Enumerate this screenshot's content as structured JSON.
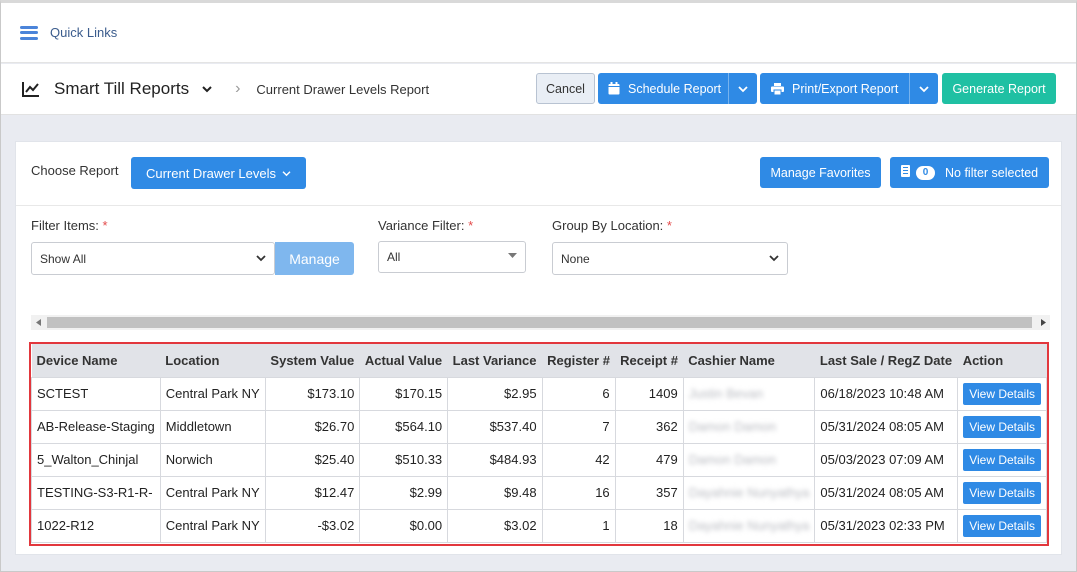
{
  "quick_links": {
    "label": "Quick Links"
  },
  "header": {
    "title": "Smart Till Reports",
    "breadcrumb": "Current Drawer Levels Report",
    "cancel_label": "Cancel",
    "schedule_label": "Schedule Report",
    "print_label": "Print/Export Report",
    "generate_label": "Generate Report"
  },
  "report": {
    "choose_label": "Choose Report",
    "selected_report": "Current Drawer Levels",
    "favorites_label": "Manage Favorites",
    "filter_count": "0",
    "filter_label": "No filter selected"
  },
  "filters": {
    "filter_items_label": "Filter Items:",
    "filter_items_value": "Show All",
    "manage_label": "Manage",
    "variance_label": "Variance Filter:",
    "variance_value": "All",
    "group_label": "Group By Location:",
    "group_value": "None",
    "required_mark": "*"
  },
  "table": {
    "columns": [
      "Device Name",
      "Location",
      "System Value",
      "Actual Value",
      "Last Variance",
      "Register #",
      "Receipt #",
      "Cashier Name",
      "Last Sale / RegZ Date",
      "Action"
    ],
    "rows": [
      {
        "device": "SCTEST",
        "location": "Central Park NY",
        "system": "$173.10",
        "actual": "$170.15",
        "variance": "$2.95",
        "register": "6",
        "receipt": "1409",
        "cashier": "Justin Bevan",
        "date": "06/18/2023 10:48 AM",
        "action": "View Details"
      },
      {
        "device": "AB-Release-Staging",
        "location": "Middletown",
        "system": "$26.70",
        "actual": "$564.10",
        "variance": "$537.40",
        "register": "7",
        "receipt": "362",
        "cashier": "Damon Damon",
        "date": "05/31/2024 08:05 AM",
        "action": "View Details"
      },
      {
        "device": "5_Walton_Chinjal",
        "location": "Norwich",
        "system": "$25.40",
        "actual": "$510.33",
        "variance": "$484.93",
        "register": "42",
        "receipt": "479",
        "cashier": "Damon Damon",
        "date": "05/03/2023 07:09 AM",
        "action": "View Details"
      },
      {
        "device": "TESTING-S3-R1-R-",
        "location": "Central Park NY",
        "system": "$12.47",
        "actual": "$2.99",
        "variance": "$9.48",
        "register": "16",
        "receipt": "357",
        "cashier": "Dayahnie Nunyathya",
        "date": "05/31/2024 08:05 AM",
        "action": "View Details"
      },
      {
        "device": "1022-R12",
        "location": "Central Park NY",
        "system": "-$3.02",
        "actual": "$0.00",
        "variance": "$3.02",
        "register": "1",
        "receipt": "18",
        "cashier": "Dayahnie Nunyathya",
        "date": "05/31/2023 02:33 PM",
        "action": "View Details"
      }
    ]
  },
  "colors": {
    "primary": "#2f8ae5",
    "generate": "#1fc0a3",
    "highlight_border": "#e2373d"
  }
}
